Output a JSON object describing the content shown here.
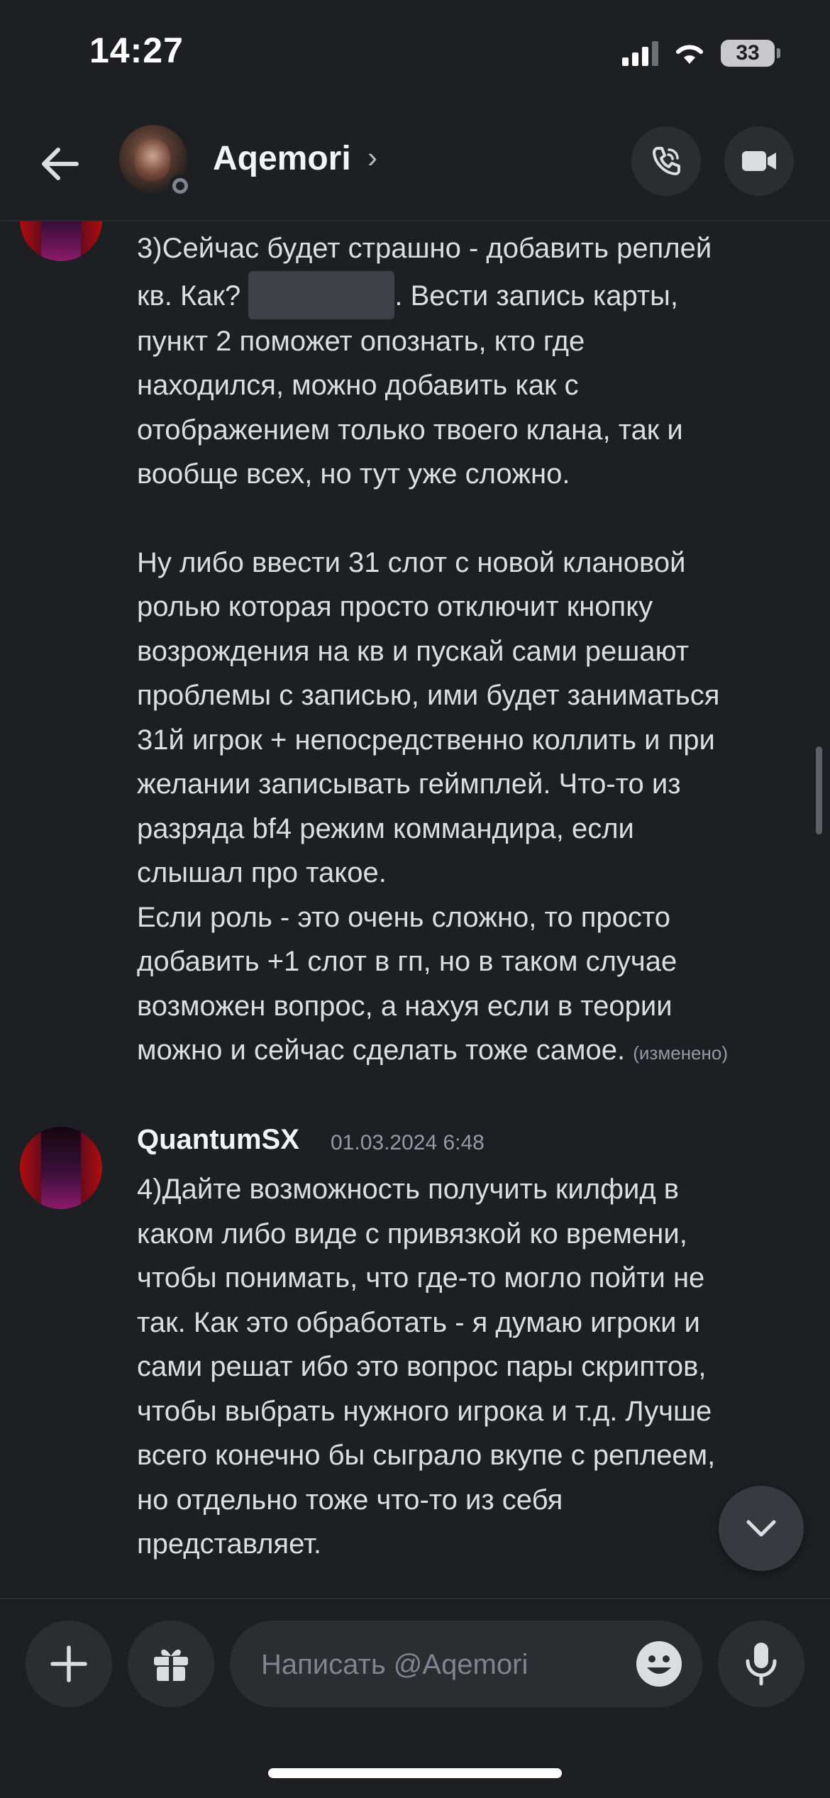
{
  "status_bar": {
    "time": "14:27",
    "battery": "33"
  },
  "header": {
    "contact_name": "Aqemori",
    "chevron": "›"
  },
  "messages": [
    {
      "id": "msg-1",
      "paragraphs": [
        [
          "3)Сейчас будет страшно - добавить реплей",
          "кв. Как? ",
          "{spoiler}",
          ". Вести запись карты,",
          "пункт 2 поможет опознать, кто где",
          "находился, можно добавить как с",
          "отображением только твоего клана, так и",
          "вообще всех, но тут уже сложно."
        ],
        [
          "Ну либо ввести 31 слот с новой клановой",
          "ролью которая просто отключит кнопку",
          "возрождения на кв и пускай сами решают",
          "проблемы с записью, ими будет заниматься",
          "31й игрок + непосредственно коллить и при",
          "желании записывать геймплей. Что-то из",
          "разряда bf4 режим коммандира, если",
          "слышал про такое.",
          "Если роль - это очень сложно, то просто",
          "добавить +1 слот в гп, но в таком случае",
          "возможен вопрос, а нахуя если в теории",
          "можно и сейчас сделать тоже самое."
        ]
      ],
      "edited_label": "(изменено)"
    },
    {
      "id": "msg-2",
      "author": "QuantumSX",
      "timestamp": "01.03.2024 6:48",
      "lines": [
        "4)Дайте возможность получить килфид в",
        "каком либо виде с привязкой ко времени,",
        "чтобы понимать, что где-то могло пойти не",
        "так. Как это обработать - я думаю игроки и",
        "сами решат ибо это вопрос пары скриптов,",
        "чтобы выбрать нужного игрока и т.д. Лучше",
        "всего конечно бы сыграло вкупе с реплеем,",
        "но отдельно тоже что-то из себя",
        "представляет."
      ]
    }
  ],
  "composer": {
    "placeholder": "Написать @Aqemori"
  },
  "icons": {
    "back": "arrow-left-icon",
    "call": "phone-icon",
    "video": "video-camera-icon",
    "add": "plus-icon",
    "gift": "gift-icon",
    "emoji": "emoji-icon",
    "mic": "microphone-icon",
    "jump": "chevron-down-icon"
  },
  "colors": {
    "background": "#1e1f23",
    "surface": "#2b2d31",
    "text": "#dbdee1",
    "muted": "#949ba4",
    "spoiler": "#3f4147"
  }
}
